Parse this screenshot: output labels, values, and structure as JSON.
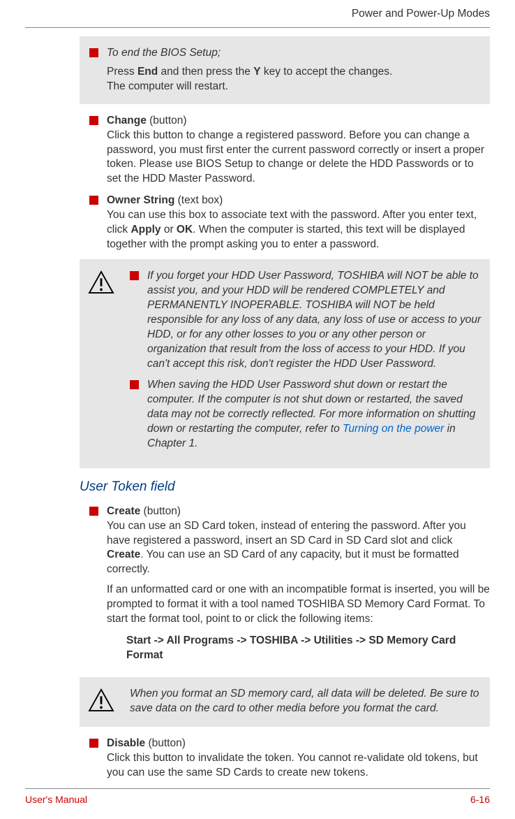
{
  "header": {
    "chapter_title": "Power and Power-Up Modes"
  },
  "box1": {
    "line1": "To end the BIOS Setup;",
    "line2_pre": "Press ",
    "line2_b1": "End",
    "line2_mid": " and then press the ",
    "line2_b2": "Y",
    "line2_end": " key to accept the changes.",
    "line3": "The computer will restart."
  },
  "bullets1": [
    {
      "title": "Change",
      "suffix": " (button)",
      "body": "Click this button to change a registered password. Before you can change a password, you must first enter the current password correctly or insert a proper token. Please use BIOS Setup to change or delete the HDD Passwords or to set the HDD Master Password."
    },
    {
      "title": "Owner String",
      "suffix": " (text box)",
      "body_pre": "You can use this box to associate text with the password. After you enter text, click ",
      "body_b1": "Apply",
      "body_mid": " or ",
      "body_b2": "OK",
      "body_end": ". When the computer is started, this text will be displayed together with the prompt asking you to enter a password."
    }
  ],
  "box2": {
    "item1": "If you forget your HDD User Password, TOSHIBA will NOT be able to assist you, and your HDD will be rendered COMPLETELY and PERMANENTLY INOPERABLE. TOSHIBA will NOT be held responsible for any loss of any data, any loss of use or access to your HDD, or for any other losses to you or any other person or organization that result from the loss of access to your HDD. If you can't accept this risk, don't register the HDD User Password.",
    "item2_pre": "When saving the HDD User Password shut down or restart the computer. If the computer is not shut down or restarted, the saved data may not be correctly reflected. For more information on shutting down or restarting the computer, refer to ",
    "item2_link": "Turning on the power",
    "item2_end": " in Chapter 1."
  },
  "section_heading": "User Token field",
  "bullets2_create": {
    "title": "Create",
    "suffix": " (button)",
    "para1_pre": "You can use an SD Card token, instead of entering the password. After you have registered a password, insert an SD Card in SD Card slot and click ",
    "para1_b": "Create",
    "para1_end": ". You can use an SD Card of any capacity, but it must be formatted correctly.",
    "para2": "If an unformatted card or one with an incompatible format is inserted, you will be prompted to format it with a tool named TOSHIBA SD Memory Card Format. To start the format tool, point to or click the following items:",
    "path": "Start -> All Programs -> TOSHIBA -> Utilities -> SD Memory Card Format"
  },
  "box3": {
    "text": "When you format an SD memory card, all data will be deleted. Be sure to save data on the card to other media before you format the card."
  },
  "bullets3_disable": {
    "title": "Disable",
    "suffix": " (button)",
    "body": "Click this button to invalidate the token. You cannot re-validate old tokens, but you can use the same SD Cards to create new tokens."
  },
  "footer": {
    "left": "User's Manual",
    "right": "6-16"
  }
}
